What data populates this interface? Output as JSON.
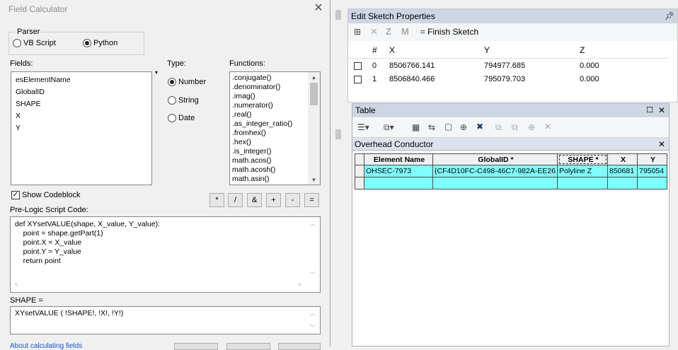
{
  "field_calculator": {
    "title": "Field Calculator",
    "parser": {
      "label": "Parser",
      "options": [
        {
          "label": "VB Script",
          "selected": false
        },
        {
          "label": "Python",
          "selected": true
        }
      ]
    },
    "fields_label": "Fields:",
    "fields": [
      "esElementName",
      "GlobalID",
      "SHAPE",
      "X",
      "Y"
    ],
    "type_label": "Type:",
    "types": [
      {
        "label": "Number",
        "selected": true
      },
      {
        "label": "String",
        "selected": false
      },
      {
        "label": "Date",
        "selected": false
      }
    ],
    "functions_label": "Functions:",
    "functions": [
      ".conjugate()",
      ".denominator()",
      ".imag()",
      ".numerator()",
      ".real()",
      ".as_integer_ratio()",
      ".fromhex()",
      ".hex()",
      ".is_integer()",
      "math.acos()",
      "math.acosh()",
      "math.asin()"
    ],
    "show_codeblock_label": "Show Codeblock",
    "show_codeblock_checked": true,
    "operators": [
      "*",
      "/",
      "&",
      "+",
      "-",
      "="
    ],
    "prelogic_label": "Pre-Logic Script Code:",
    "prelogic_code": [
      "def XYsetVALUE(shape, X_value, Y_value):",
      "    point = shape.getPart(1)",
      "    point.X = X_value",
      "    point.Y = Y_value",
      "    return point"
    ],
    "expression_label": "SHAPE =",
    "expression": "XYsetVALUE ( !SHAPE!, !X!, !Y!)",
    "bottom_link": "About calculating fields"
  },
  "edit_sketch": {
    "title": "Edit Sketch Properties",
    "finish_label": "Finish Sketch",
    "toolbar_icons": [
      "sketch-properties-icon",
      "delete-vertex-icon",
      "z-icon",
      "m-icon",
      "finish-sketch-icon"
    ],
    "columns": [
      "#",
      "X",
      "Y",
      "Z"
    ],
    "rows": [
      {
        "n": "0",
        "x": "8506766.141",
        "y": "794977.685",
        "z": "0.000"
      },
      {
        "n": "1",
        "x": "8506840.466",
        "y": "795079.703",
        "z": "0.000"
      }
    ]
  },
  "table": {
    "title": "Table",
    "layer_title": "Overhead Conductor",
    "columns": [
      "Element Name",
      "GlobalID *",
      "SHAPE *",
      "X",
      "Y"
    ],
    "rows": [
      {
        "name": "OHSEC-7973",
        "globalid": "{CF4D10FC-C498-46C7-982A-EE26",
        "shape": "Polyline Z",
        "x": "850681",
        "y": "795054"
      }
    ]
  }
}
